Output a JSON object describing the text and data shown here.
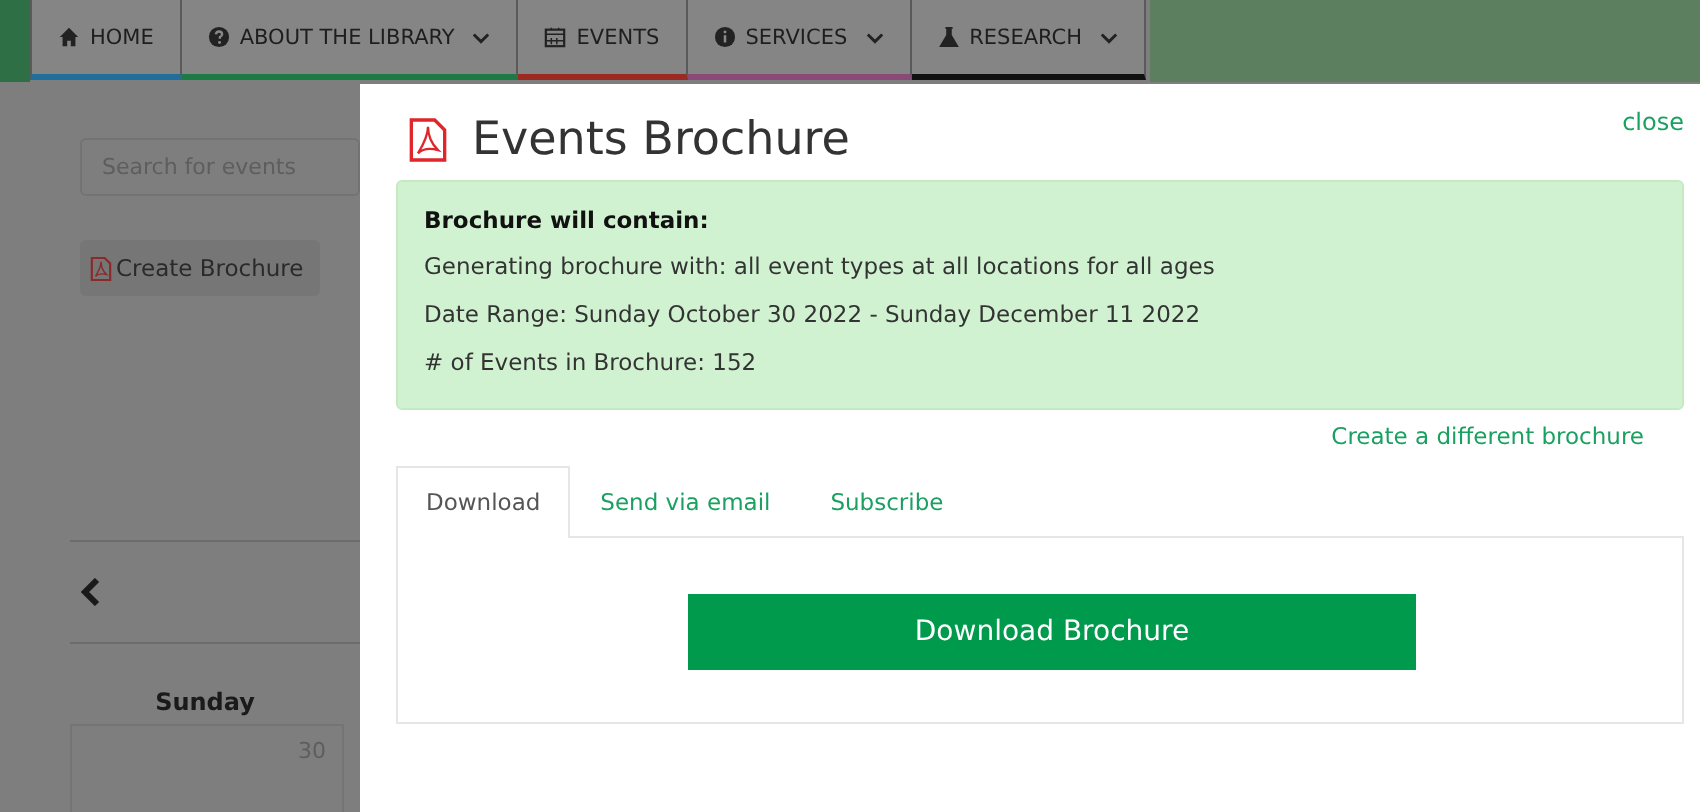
{
  "nav": [
    {
      "label": "HOME",
      "color": "#1f6f9a",
      "dropdown": false
    },
    {
      "label": "ABOUT THE LIBRARY",
      "color": "#1c7a44",
      "dropdown": true
    },
    {
      "label": "EVENTS",
      "color": "#9a2a22",
      "dropdown": false
    },
    {
      "label": "SERVICES",
      "color": "#8a4a78",
      "dropdown": true
    },
    {
      "label": "RESEARCH",
      "color": "#111111",
      "dropdown": true
    }
  ],
  "page": {
    "search": {
      "placeholder": "Search for events"
    },
    "create_button": "Create Brochure",
    "day_header": "Sunday",
    "day_number": "30"
  },
  "modal": {
    "title": "Events Brochure",
    "close": "close",
    "summary": {
      "heading": "Brochure will contain:",
      "lines": [
        "Generating brochure with: all event types at all locations for all ages",
        "Date Range: Sunday October 30 2022 - Sunday December 11 2022",
        "# of Events in Brochure: 152"
      ]
    },
    "different_link": "Create a different brochure",
    "tabs": [
      {
        "label": "Download",
        "selected": true
      },
      {
        "label": "Send via email",
        "selected": false
      },
      {
        "label": "Subscribe",
        "selected": false
      }
    ],
    "download_button": "Download Brochure"
  }
}
